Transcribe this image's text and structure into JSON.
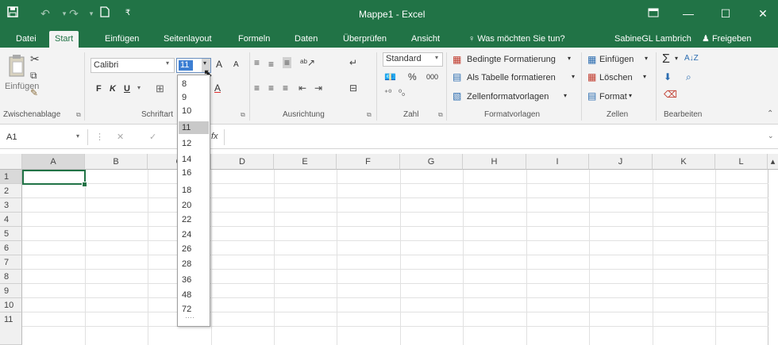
{
  "window": {
    "title": "Mappe1 - Excel",
    "qat": {
      "save_icon": "save-icon",
      "undo_icon": "undo-icon",
      "redo_icon": "redo-icon",
      "new_icon": "new-file-icon"
    },
    "controls": {
      "ribbon_display": "⊡",
      "minimize": "—",
      "maximize": "☐",
      "close": "✕"
    }
  },
  "tabs": [
    "Datei",
    "Start",
    "Einfügen",
    "Seitenlayout",
    "Formeln",
    "Daten",
    "Überprüfen",
    "Ansicht"
  ],
  "active_tab": "Start",
  "tell_me": "Was möchten Sie tun?",
  "user": "SabineGL Lambrich",
  "share": "Freigeben",
  "ribbon": {
    "clipboard": {
      "paste": "Einfügen",
      "label": "Zwischenablage"
    },
    "font": {
      "name": "Calibri",
      "size": "11",
      "bold": "F",
      "italic": "K",
      "underline": "U",
      "label": "Schriftart",
      "grow": "A",
      "shrink": "A",
      "color": "A"
    },
    "alignment": {
      "label": "Ausrichtung"
    },
    "number": {
      "format": "Standard",
      "percent": "%",
      "thousands": "000",
      "label": "Zahl"
    },
    "styles": {
      "conditional": "Bedingte Formatierung",
      "as_table": "Als Tabelle formatieren",
      "cell_styles": "Zellenformatvorlagen",
      "label": "Formatvorlagen"
    },
    "cells": {
      "insert": "Einfügen",
      "delete": "Löschen",
      "format": "Format",
      "label": "Zellen"
    },
    "editing": {
      "label": "Bearbeiten",
      "sum": "Σ"
    }
  },
  "formula_bar": {
    "name_box": "A1",
    "cancel": "✕",
    "enter": "✓",
    "fx": "fx",
    "value": ""
  },
  "columns": [
    "A",
    "B",
    "C",
    "D",
    "E",
    "F",
    "G",
    "H",
    "I",
    "J",
    "K",
    "L"
  ],
  "rows": [
    "1",
    "2",
    "3",
    "4",
    "5",
    "6",
    "7",
    "8",
    "9",
    "10",
    "11"
  ],
  "font_size_dropdown": {
    "options": [
      "8",
      "9",
      "10",
      "11",
      "12",
      "14",
      "16",
      "18",
      "20",
      "22",
      "24",
      "26",
      "28",
      "36",
      "48",
      "72"
    ],
    "selected": "11",
    "more": "····"
  }
}
